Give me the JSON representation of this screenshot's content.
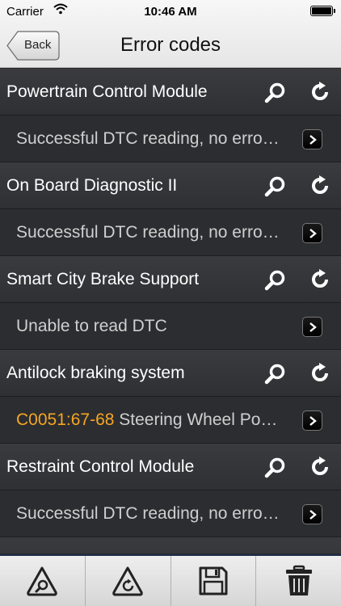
{
  "status": {
    "carrier": "Carrier",
    "time": "10:46 AM"
  },
  "nav": {
    "back_label": "Back",
    "title": "Error codes"
  },
  "modules": [
    {
      "name": "Powertrain Control Module",
      "code": "",
      "message": "Successful DTC reading, no erro…"
    },
    {
      "name": "On Board Diagnostic II",
      "code": "",
      "message": "Successful DTC reading, no erro…"
    },
    {
      "name": "Smart City Brake Support",
      "code": "",
      "message": "Unable to read DTC"
    },
    {
      "name": "Antilock braking system",
      "code": "C0051:67-68",
      "message": "Steering Wheel Po…"
    },
    {
      "name": "Restraint Control Module",
      "code": "",
      "message": "Successful DTC reading, no erro…"
    }
  ],
  "colors": {
    "error_code": "#f5a623",
    "toolbar_border": "#1e2d4a"
  },
  "toolbar": {
    "icons": [
      "diagnose-icon",
      "clear-diagnose-icon",
      "save-icon",
      "trash-icon"
    ]
  }
}
